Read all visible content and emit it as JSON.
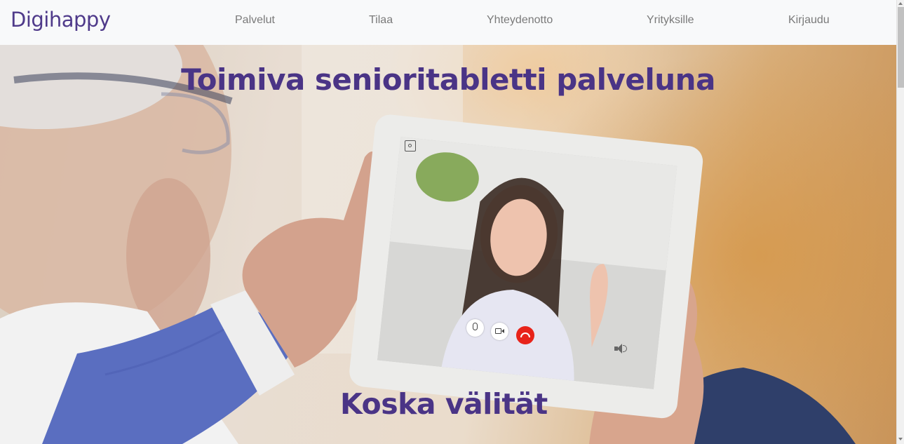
{
  "navbar": {
    "brand": "Digihappy",
    "links": [
      "Palvelut",
      "Tilaa",
      "Yhteydenotto",
      "Yrityksille",
      "Kirjaudu"
    ]
  },
  "hero": {
    "title": "Toimiva senioritabletti palveluna",
    "subtitle": "Koska välität",
    "call_controls": [
      "microphone-icon",
      "video-camera-icon",
      "end-call-icon",
      "speaker-icon",
      "screenshot-icon"
    ]
  },
  "colors": {
    "brand": "#4f3a8a",
    "heading": "#4a3486",
    "nav_text": "#7a7a7a",
    "navbar_bg": "#f8f9fa",
    "end_call": "#e8231a"
  }
}
